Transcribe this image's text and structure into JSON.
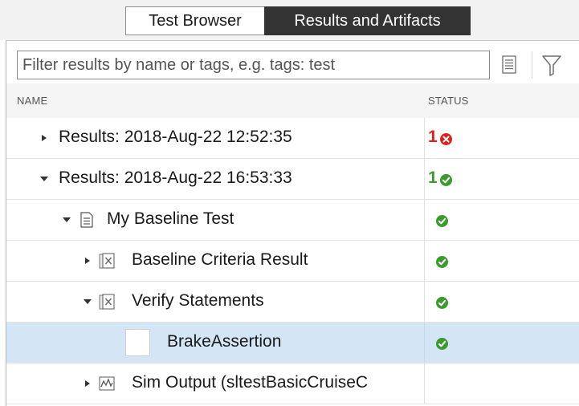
{
  "tabs": {
    "test_browser": "Test Browser",
    "results_artifacts": "Results and Artifacts"
  },
  "filter": {
    "placeholder": "Filter results by name or tags, e.g. tags: test",
    "value": ""
  },
  "columns": {
    "name": "NAME",
    "status": "STATUS"
  },
  "rows": [
    {
      "label": "Results: 2018-Aug-22 12:52:35",
      "count": "1",
      "status": "fail",
      "expanded": false
    },
    {
      "label": "Results: 2018-Aug-22 16:53:33",
      "count": "1",
      "status": "pass",
      "expanded": true
    },
    {
      "label": "My Baseline Test",
      "status": "pass",
      "icon": "document-icon",
      "expanded": true
    },
    {
      "label": "Baseline Criteria Result",
      "status": "pass",
      "icon": "criteria-icon",
      "expanded": false
    },
    {
      "label": "Verify Statements",
      "status": "pass",
      "icon": "criteria-icon",
      "expanded": true
    },
    {
      "label": "BrakeAssertion",
      "status": "pass",
      "selected": true
    },
    {
      "label": "Sim Output (sltestBasicCruiseC",
      "icon": "signal-icon",
      "expanded": false
    }
  ],
  "colors": {
    "fail": "#e0201b",
    "pass": "#3c9a2e",
    "selected_row": "#d4e6f6",
    "active_tab": "#333333"
  }
}
